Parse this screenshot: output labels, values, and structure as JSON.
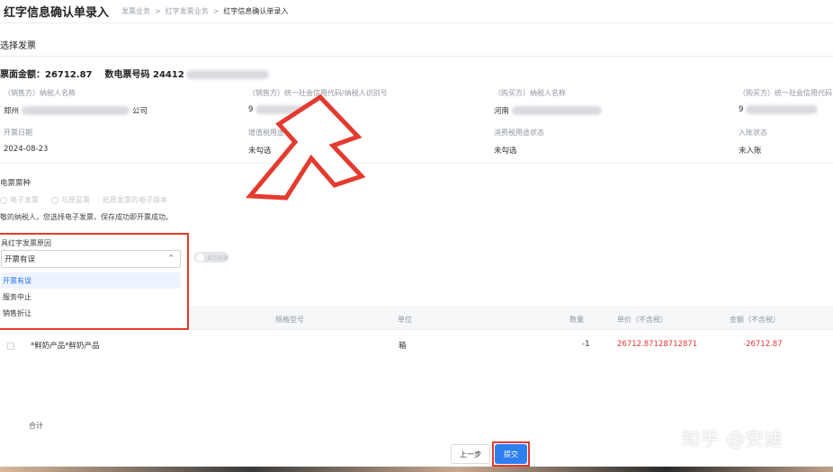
{
  "header": {
    "title": "红字信息确认单录入",
    "breadcrumb": [
      "发票业务",
      "红字发票业务",
      "红字信息确认单录入"
    ]
  },
  "section_title": "选择发票",
  "summary": {
    "amount": "票面金额：26712.87",
    "invoice_no": "数电票号码 24412"
  },
  "info": {
    "seller_name_label": "（销售方）纳税人名称",
    "seller_name_value": "郑州",
    "seller_name_suffix": "公司",
    "seller_id_label": "（销售方）统一社会信用代码/纳税人识别号",
    "seller_id_value": "9",
    "buyer_name_label": "（购买方）纳税人名称",
    "buyer_name_value": "河南",
    "buyer_id_label": "（购买方）统一社会信用代码",
    "buyer_id_value": "9",
    "issue_date_label": "开票日期",
    "issue_date_value": "2024-08-23",
    "usage_label": "增值税用途状态",
    "usage_value": "未勾选",
    "consumption_label": "消费税用途状态",
    "consumption_value": "未勾选",
    "entry_label": "入账状态",
    "entry_value": "未入账"
  },
  "e_invoice": {
    "label": "电票票种",
    "options": [
      "电子发票",
      "与原蓝票",
      "纸质发票的电子版本"
    ],
    "hint": "敬的纳税人，您选择电子发票，保存成功即开票成功。"
  },
  "reason": {
    "label": "具红字发票原因",
    "selected": "开票有误",
    "options": [
      "开票有误",
      "服务中止",
      "销售折让"
    ]
  },
  "toggle_text": "显示全部",
  "table": {
    "headers": [
      "规格型号",
      "单位",
      "数量",
      "单价（不含税）",
      "金额（不含税）"
    ],
    "rows": [
      {
        "name": "*鲜奶产品*鲜奶产品",
        "unit": "箱",
        "qty": "-1",
        "price": "26712.87128712871",
        "amount": "-26712.87"
      }
    ],
    "total_label": "合计"
  },
  "buttons": {
    "prev": "上一步",
    "submit": "提交"
  },
  "watermark": "知乎 @安迪",
  "colors": {
    "accent": "#2f7ff0",
    "highlight": "#e43a2f",
    "negative": "#e03a3a"
  }
}
